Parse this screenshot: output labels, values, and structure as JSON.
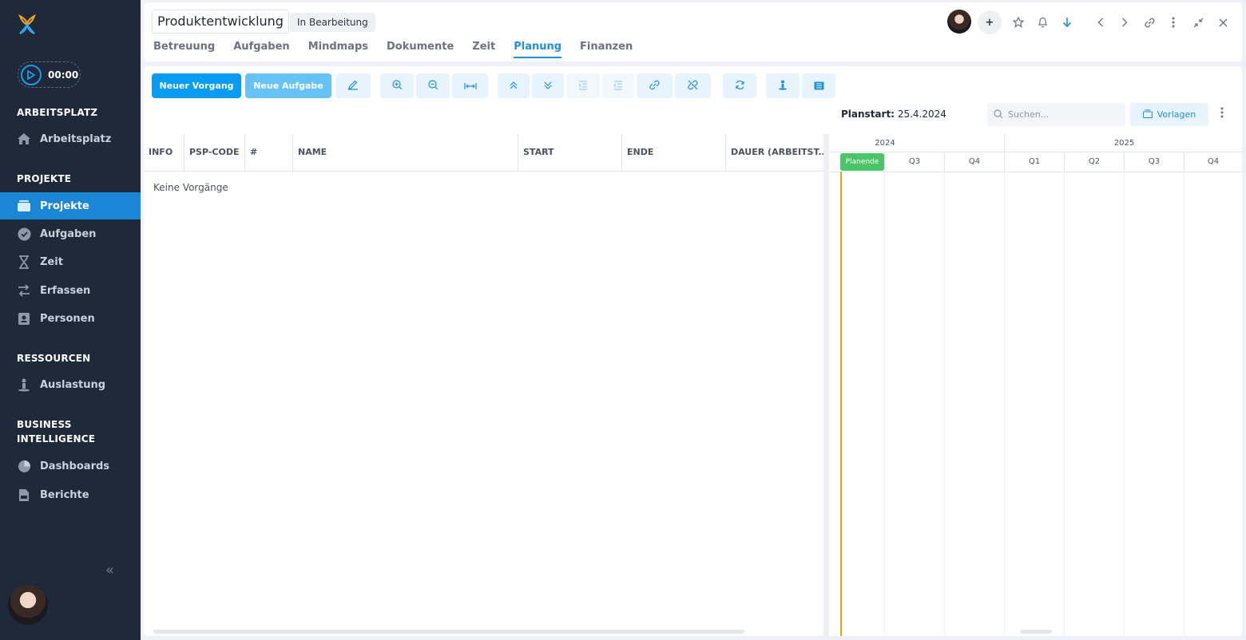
{
  "sidebar": {
    "timer": "00:00",
    "sections": [
      {
        "title": "ARBEITSPLATZ"
      },
      {
        "title": "PROJEKTE"
      },
      {
        "title": "RESSOURCEN"
      },
      {
        "title": "BUSINESS INTELLIGENCE"
      }
    ],
    "items": [
      {
        "label": "Arbeitsplatz",
        "icon": "home-icon"
      },
      {
        "label": "Projekte",
        "icon": "folder-icon",
        "active": true
      },
      {
        "label": "Aufgaben",
        "icon": "check-circle-icon"
      },
      {
        "label": "Zeit",
        "icon": "hourglass-icon"
      },
      {
        "label": "Erfassen",
        "icon": "transfer-icon"
      },
      {
        "label": "Personen",
        "icon": "contact-icon"
      },
      {
        "label": "Auslastung",
        "icon": "person-workload-icon"
      },
      {
        "label": "Dashboards",
        "icon": "pie-chart-icon"
      },
      {
        "label": "Berichte",
        "icon": "report-icon"
      }
    ],
    "accent": "#1b86d6"
  },
  "header": {
    "title": "Produktentwicklung",
    "status": "In Bearbeitung",
    "add_label": "+",
    "tabs": [
      "Betreuung",
      "Aufgaben",
      "Mindmaps",
      "Dokumente",
      "Zeit",
      "Planung",
      "Finanzen"
    ],
    "active_tab": "Planung"
  },
  "toolbar": {
    "new_process": "Neuer Vorgang",
    "new_task": "Neue Aufgabe",
    "planstart_label": "Planstart:",
    "planstart_value": "25.4.2024",
    "search_placeholder": "Suchen...",
    "templates": "Vorlagen"
  },
  "grid": {
    "columns": [
      "INFO",
      "PSP-CODE",
      "#",
      "NAME",
      "START",
      "ENDE",
      "DAUER (ARBEITST..."
    ],
    "empty": "Keine Vorgänge"
  },
  "gantt": {
    "years": [
      "2024",
      "2025"
    ],
    "quarters": [
      "Planende",
      "Q3",
      "Q4",
      "Q1",
      "Q2",
      "Q3",
      "Q4"
    ],
    "plan_end_color": "#4cc46a",
    "today_line_color": "#f59e0b"
  }
}
